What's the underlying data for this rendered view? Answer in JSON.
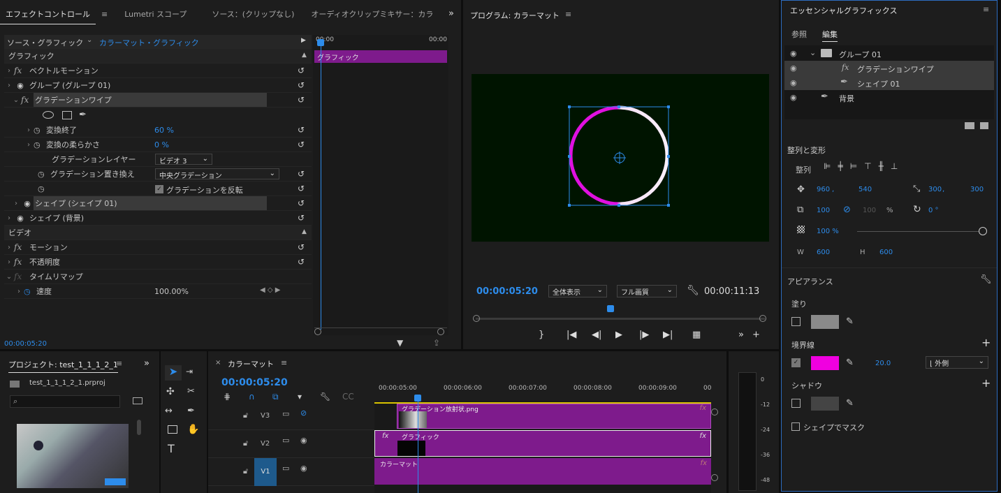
{
  "effect_controls": {
    "tabs": [
      "エフェクトコントロール",
      "Lumetri スコープ",
      "ソース：(クリップなし)",
      "オーディオクリップミキサー：カラ"
    ],
    "tab_more": "»",
    "source_label": "ソース・グラフィック",
    "clip_label": "カラーマット・グラフィック",
    "mini_times": [
      "00:00",
      "00:00"
    ],
    "mini_clip": "グラフィック",
    "section_graphic": "グラフィック",
    "rows": {
      "vector_motion": "ベクトルモーション",
      "group": "グループ (グループ 01)",
      "gradient_wipe": "グラデーションワイプ",
      "transition_end": "変換終了",
      "transition_end_val": "60 %",
      "transition_soft": "変換の柔らかさ",
      "transition_soft_val": "0 %",
      "gradient_layer": "グラデーションレイヤー",
      "gradient_layer_val": "ビデオ 3",
      "gradient_replace": "グラデーション置き換え",
      "gradient_replace_val": "中央グラデーション",
      "invert_label": "グラデーションを反転",
      "shape": "シェイプ (シェイプ 01)",
      "shape_bg": "シェイプ (背景)"
    },
    "section_video": "ビデオ",
    "video_rows": {
      "motion": "モーション",
      "opacity": "不透明度",
      "time_remap": "タイムリマップ",
      "speed": "速度",
      "speed_val": "100.00%"
    },
    "timecode": "00:00:05:20"
  },
  "program": {
    "title": "プログラム: カラーマット",
    "timecode": "00:00:05:20",
    "fit": "全体表示",
    "quality": "フル画質",
    "duration": "00:00:11:13",
    "bg_color": "#001400",
    "stroke_color_left": "#e010e0",
    "stroke_color_right": "#f5e0f5"
  },
  "essential_graphics": {
    "title": "エッセンシャルグラフィックス",
    "tabs": [
      "参照",
      "編集"
    ],
    "layers": {
      "group": "グループ 01",
      "gradient": "グラデーションワイプ",
      "shape": "シェイプ 01",
      "bg": "背景"
    },
    "align_title": "整列と変形",
    "align_label": "整列",
    "pos_x": "960",
    "pos_y": "540",
    "anchor_x": "300",
    "anchor_y": "300",
    "scale": "100",
    "scale2": "100",
    "scale_unit": "%",
    "rotation": "0 °",
    "opacity": "100 %",
    "opacity_value": 1.0,
    "w_label": "W",
    "w_val": "600",
    "h_label": "H",
    "h_val": "600",
    "appearance": "アピアランス",
    "fill": "塗り",
    "fill_color": "#8a8a8a",
    "stroke": "境界線",
    "stroke_color": "#f000e0",
    "stroke_width": "20.0",
    "stroke_pos": "外側",
    "shadow": "シャドウ",
    "mask": "シェイプでマスク"
  },
  "project": {
    "title": "プロジェクト: test_1_1_1_2_1",
    "file": "test_1_1_1_2_1.prproj"
  },
  "timeline": {
    "title": "カラーマット",
    "timecode": "00:00:05:20",
    "ruler": [
      "00:00:05:00",
      "00:00:06:00",
      "00:00:07:00",
      "00:00:08:00",
      "00:00:09:00",
      "00"
    ],
    "tracks": [
      "V3",
      "V2",
      "V1"
    ],
    "clips": {
      "v3": "グラデーション放射状.png",
      "v2": "グラフィック",
      "v1": "カラーマット"
    },
    "meter_labels": [
      "0",
      "-12",
      "-24",
      "-36",
      "-48"
    ]
  }
}
